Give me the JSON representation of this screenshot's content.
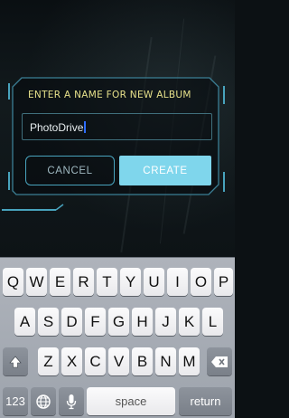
{
  "dialog": {
    "title": "ENTER A NAME FOR NEW ALBUM",
    "input_value": "PhotoDrive",
    "cancel_label": "CANCEL",
    "create_label": "CREATE"
  },
  "keyboard": {
    "row1": [
      "Q",
      "W",
      "E",
      "R",
      "T",
      "Y",
      "U",
      "I",
      "O",
      "P"
    ],
    "row2": [
      "A",
      "S",
      "D",
      "F",
      "G",
      "H",
      "J",
      "K",
      "L"
    ],
    "row3": [
      "Z",
      "X",
      "C",
      "V",
      "B",
      "N",
      "M"
    ],
    "numbers_label": "123",
    "space_label": "space",
    "return_label": "return",
    "shift_icon": "shift-icon",
    "delete_icon": "delete-icon",
    "globe_icon": "globe-icon",
    "mic_icon": "microphone-icon"
  },
  "colors": {
    "accent": "#7fd6ec",
    "frame": "#48a3bd",
    "title": "#e6e08a"
  }
}
